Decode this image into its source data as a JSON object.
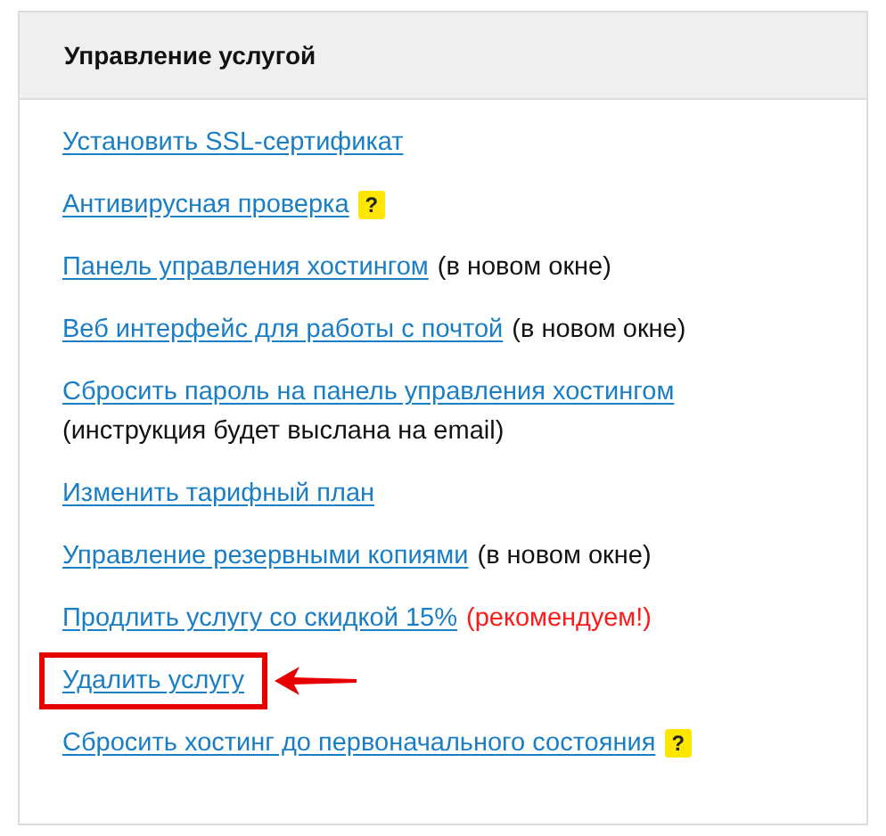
{
  "panel": {
    "title": "Управление услугой",
    "items": [
      {
        "link": "Установить SSL-сертификат",
        "highlighted": false
      },
      {
        "link": "Антивирусная проверка",
        "help_badge": "?",
        "highlighted": false
      },
      {
        "link": "Панель управления хостингом",
        "note": {
          "text": "(в новом окне)",
          "color": "#111111",
          "on_new_line": false
        },
        "highlighted": false
      },
      {
        "link": "Веб интерфейс для работы с почтой",
        "note": {
          "text": "(в новом окне)",
          "color": "#111111",
          "on_new_line": false
        },
        "highlighted": false
      },
      {
        "link": "Сбросить пароль на панель управления хостингом",
        "note": {
          "text": "(инструкция будет выслана на email)",
          "color": "#111111",
          "on_new_line": true
        },
        "highlighted": false
      },
      {
        "link": "Изменить тарифный план",
        "highlighted": false
      },
      {
        "link": "Управление резервными копиями",
        "note": {
          "text": "(в новом окне)",
          "color": "#111111",
          "on_new_line": false
        },
        "highlighted": false
      },
      {
        "link": "Продлить услугу со скидкой 15%",
        "note": {
          "text": "(рекомендуем!)",
          "color": "#ff1a1a",
          "on_new_line": false
        },
        "highlighted": false
      },
      {
        "link": "Удалить услугу",
        "highlighted": true
      },
      {
        "link": "Сбросить хостинг до первоначального состояния",
        "help_badge": "?",
        "highlighted": false
      }
    ]
  }
}
